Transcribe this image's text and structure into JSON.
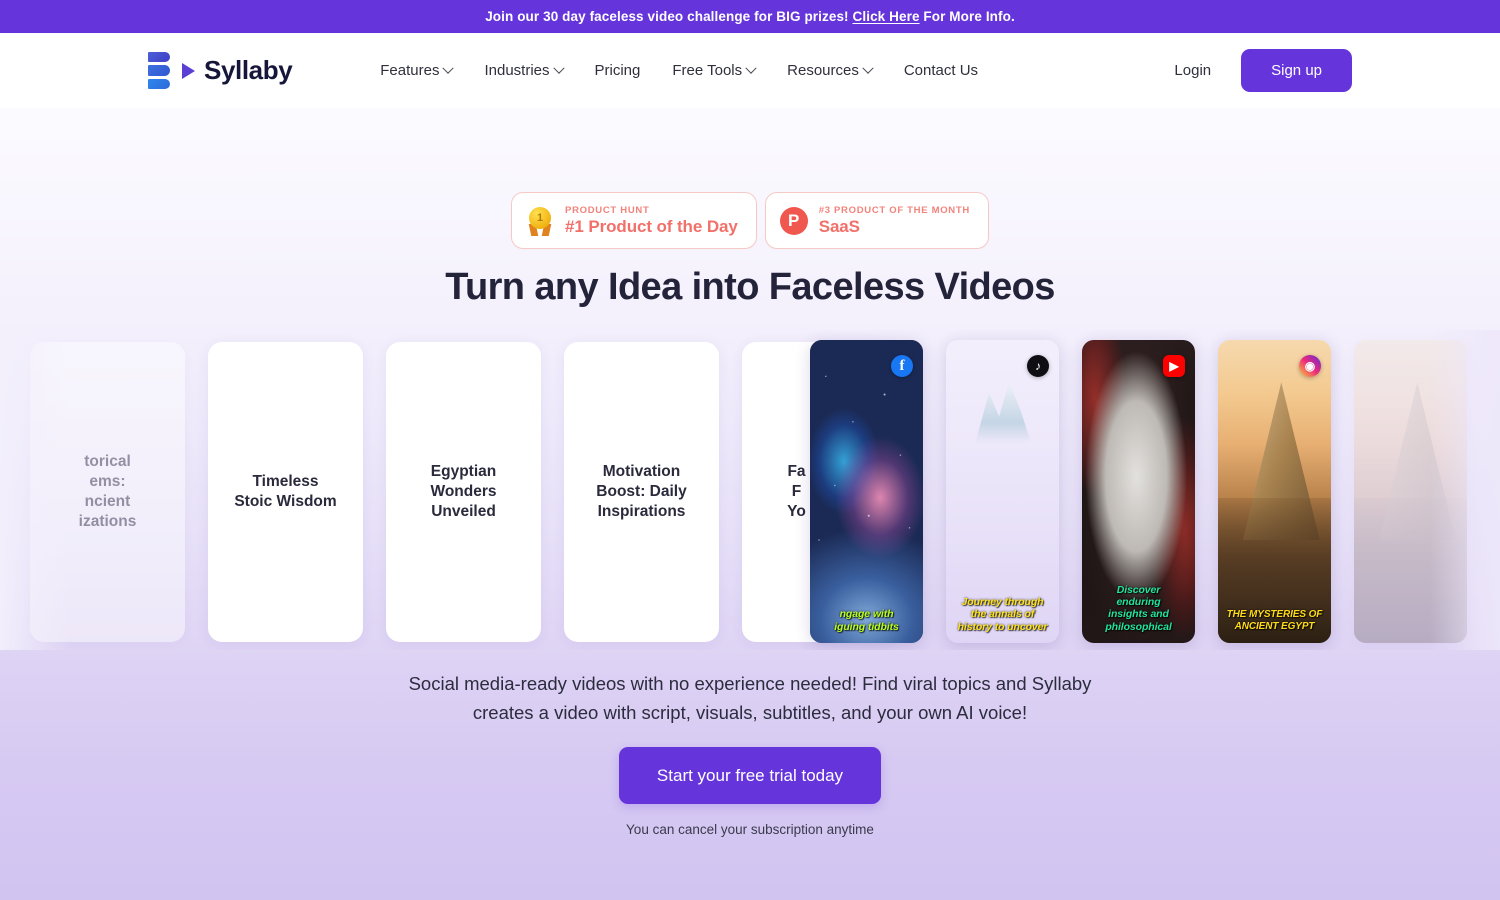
{
  "announcement": {
    "before": "Join our 30 day faceless video challenge for BIG prizes! ",
    "link": "Click Here",
    "after": " For More Info."
  },
  "nav": {
    "brand": "Syllaby",
    "links": [
      {
        "label": "Features",
        "caret": true
      },
      {
        "label": "Industries",
        "caret": true
      },
      {
        "label": "Pricing",
        "caret": false
      },
      {
        "label": "Free Tools",
        "caret": true
      },
      {
        "label": "Resources",
        "caret": true
      },
      {
        "label": "Contact Us",
        "caret": false
      }
    ],
    "login": "Login",
    "signup": "Sign up"
  },
  "badges": [
    {
      "icon": "gold-medal-icon",
      "medal_number": "1",
      "kicker": "PRODUCT HUNT",
      "title": "#1 Product of the Day"
    },
    {
      "icon": "product-hunt-icon",
      "medal_number": "P",
      "kicker": "#3 PRODUCT OF THE MONTH",
      "title": "SaaS"
    }
  ],
  "hero": {
    "headline": "Turn any Idea into Faceless Videos",
    "subcopy_line1": "Social media-ready videos with no experience needed! Find viral topics and Syllaby",
    "subcopy_line2": "creates a video with script, visuals, subtitles, and your own AI voice!",
    "cta": "Start your free trial today",
    "note": "You can cancel your subscription anytime"
  },
  "carousel": {
    "text_cards": [
      {
        "title": "torical\nems:\nncient\nizations",
        "clipped": true
      },
      {
        "title": "Timeless\nStoic Wisdom",
        "clipped": false
      },
      {
        "title": "Egyptian\nWonders\nUnveiled",
        "clipped": false
      },
      {
        "title": "Motivation\nBoost: Daily\nInspirations",
        "clipped": false
      },
      {
        "title": "Fa\nF\nYo",
        "clipped": true
      }
    ],
    "video_cards": [
      {
        "platform": "facebook-icon",
        "glyph": "f",
        "caption": "ngage with\niguing tidbits",
        "caption_color": "#b9ff1f",
        "art": "galaxy"
      },
      {
        "platform": "tiktok-icon",
        "glyph": "♪",
        "caption": "Journey through\nthe annals of\nhistory to uncover",
        "caption_color": "#ffe21f",
        "art": "canyon"
      },
      {
        "platform": "youtube-icon",
        "glyph": "▶",
        "caption": "Discover\nenduring\ninsights and\nphilosophical",
        "caption_color": "#22e39b",
        "art": "statue"
      },
      {
        "platform": "instagram-icon",
        "glyph": "◉",
        "caption": "THE MYSTERIES OF\nANCIENT EGYPT",
        "caption_color": "#ffdb18",
        "art": "pyramid"
      }
    ]
  },
  "colors": {
    "brand_purple": "#6535DB",
    "badge_red": "#F2706A",
    "headline": "#23233A"
  }
}
